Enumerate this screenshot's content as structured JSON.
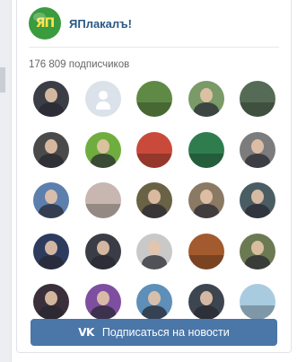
{
  "group": {
    "name": "ЯПлакалъ!",
    "logo_text": "ЯП",
    "subscribers_text": "176 809 подписчиков"
  },
  "subscribe_button": {
    "label": "Подписаться на новости",
    "icon": "vk-logo-icon"
  },
  "colors": {
    "link": "#2a5885",
    "button": "#4a76a8",
    "logo_bg": "#3a9b3f"
  },
  "avatars": [
    {
      "kind": "person",
      "bg": "#3b3e45",
      "icon": "person-photo"
    },
    {
      "kind": "placeholder",
      "bg": "#dbe2ea",
      "icon": "default-user-icon"
    },
    {
      "kind": "landscape",
      "bg": "#5f8a45",
      "icon": "nature-photo"
    },
    {
      "kind": "person",
      "bg": "#7a9a68",
      "icon": "person-photo"
    },
    {
      "kind": "landscape",
      "bg": "#556b55",
      "icon": "nature-photo"
    },
    {
      "kind": "person",
      "bg": "#4a4a4a",
      "icon": "person-photo"
    },
    {
      "kind": "person",
      "bg": "#6fae3e",
      "icon": "person-photo"
    },
    {
      "kind": "landscape",
      "bg": "#c94a3a",
      "icon": "cartoon-photo"
    },
    {
      "kind": "landscape",
      "bg": "#2f7d4f",
      "icon": "cartoon-photo"
    },
    {
      "kind": "person",
      "bg": "#7c7c7c",
      "icon": "person-photo"
    },
    {
      "kind": "person",
      "bg": "#5c7fae",
      "icon": "person-photo"
    },
    {
      "kind": "landscape",
      "bg": "#c7b7b0",
      "icon": "cat-photo"
    },
    {
      "kind": "person",
      "bg": "#6a6245",
      "icon": "person-photo"
    },
    {
      "kind": "person",
      "bg": "#8a7a63",
      "icon": "person-photo"
    },
    {
      "kind": "person",
      "bg": "#4a5d63",
      "icon": "person-photo"
    },
    {
      "kind": "person",
      "bg": "#2d3b5e",
      "icon": "person-photo"
    },
    {
      "kind": "person",
      "bg": "#3a3d45",
      "icon": "person-photo"
    },
    {
      "kind": "person",
      "bg": "#c9c9c9",
      "icon": "person-photo"
    },
    {
      "kind": "landscape",
      "bg": "#a35a2e",
      "icon": "group-photo"
    },
    {
      "kind": "person",
      "bg": "#6b7a52",
      "icon": "person-photo"
    },
    {
      "kind": "person",
      "bg": "#3a2f3a",
      "icon": "person-photo"
    },
    {
      "kind": "person",
      "bg": "#7e4fa0",
      "icon": "person-photo"
    },
    {
      "kind": "person",
      "bg": "#5d8fb8",
      "icon": "person-photo"
    },
    {
      "kind": "person",
      "bg": "#3d4550",
      "icon": "person-photo"
    },
    {
      "kind": "landscape",
      "bg": "#a9cbe0",
      "icon": "beach-photo"
    }
  ]
}
